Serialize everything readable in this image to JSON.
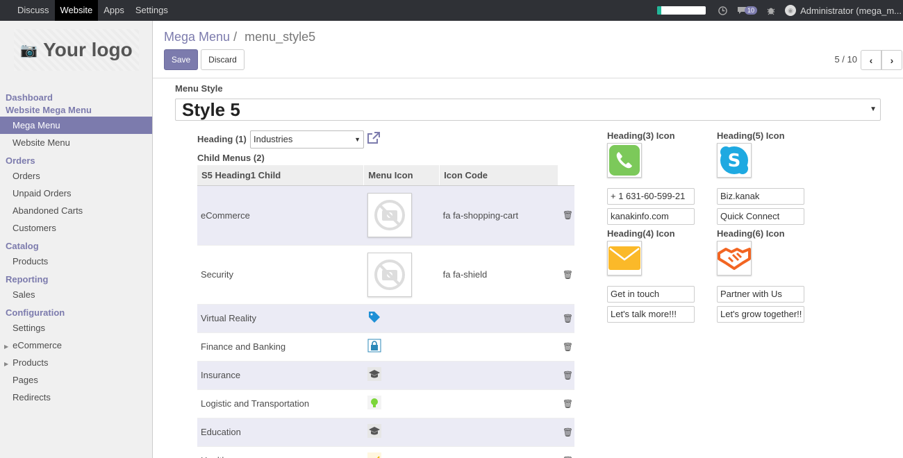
{
  "topbar": {
    "menu": [
      "Discuss",
      "Website",
      "Apps",
      "Settings"
    ],
    "active_menu": "Website",
    "progress": 0.08,
    "chat_count": "10",
    "user": "Administrator (mega_m..."
  },
  "sidebar": {
    "logo_text": "Your logo",
    "sections": [
      {
        "title": "Dashboard",
        "items": []
      },
      {
        "title": "Website Mega Menu",
        "items": [
          "Mega Menu",
          "Website Menu"
        ]
      },
      {
        "title": "Orders",
        "items": [
          "Orders",
          "Unpaid Orders",
          "Abandoned Carts",
          "Customers"
        ]
      },
      {
        "title": "Catalog",
        "items": [
          "Products"
        ]
      },
      {
        "title": "Reporting",
        "items": [
          "Sales"
        ]
      },
      {
        "title": "Configuration",
        "items": [
          "Settings",
          "eCommerce",
          "Products",
          "Pages",
          "Redirects"
        ]
      }
    ],
    "active_item": "Mega Menu"
  },
  "control_panel": {
    "breadcrumb_parent": "Mega Menu",
    "breadcrumb_sep": "/",
    "breadcrumb_current": "menu_style5",
    "save_label": "Save",
    "discard_label": "Discard",
    "pager": "5 / 10"
  },
  "form": {
    "menu_style_label": "Menu Style",
    "menu_style_value": "Style 5",
    "heading1_label": "Heading (1)",
    "heading1_value": "Industries",
    "child_menus_label": "Child Menus (2)",
    "table": {
      "headers": [
        "S5 Heading1 Child",
        "Menu Icon",
        "Icon Code"
      ],
      "rows": [
        {
          "name": "eCommerce",
          "icon": "no-image",
          "code": "fa fa-shopping-cart"
        },
        {
          "name": "Security",
          "icon": "no-image",
          "code": "fa fa-shield"
        },
        {
          "name": "Virtual Reality",
          "icon": "tag-icon",
          "code": ""
        },
        {
          "name": "Finance and Banking",
          "icon": "lock-icon",
          "code": ""
        },
        {
          "name": "Insurance",
          "icon": "graduation-cap-icon",
          "code": ""
        },
        {
          "name": "Logistic and Transportation",
          "icon": "lightbulb-icon",
          "code": ""
        },
        {
          "name": "Education",
          "icon": "graduation-cap-icon",
          "code": ""
        },
        {
          "name": "Healthcare",
          "icon": "chart-icon",
          "code": ""
        }
      ]
    },
    "heading3": {
      "label": "Heading(3) Icon",
      "field1": "+ 1 631-60-599-21",
      "field2": "kanakinfo.com"
    },
    "heading5": {
      "label": "Heading(5) Icon",
      "field1": "Biz.kanak",
      "field2": "Quick Connect"
    },
    "heading4": {
      "label": "Heading(4) Icon",
      "field1": "Get in touch",
      "field2": "Let's talk more!!!"
    },
    "heading6": {
      "label": "Heading(6) Icon",
      "field1": "Partner with Us",
      "field2": "Let's grow together!!"
    }
  },
  "colors": {
    "brand": "#7c7bad",
    "phone": "#7cc95a",
    "skype": "#1ea9e1",
    "mail": "#fbb929",
    "handshake": "#f26522"
  }
}
